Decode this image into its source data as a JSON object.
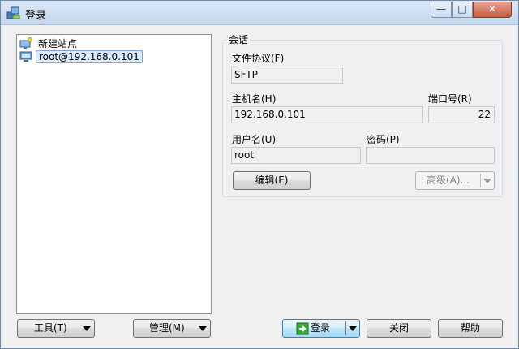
{
  "window": {
    "title": "登录",
    "minimize_glyph": "—",
    "maximize_glyph": "□",
    "close_glyph": "✕"
  },
  "sites": {
    "items": [
      {
        "label": "新建站点",
        "icon": "new-site-icon"
      },
      {
        "label": "root@192.168.0.101",
        "icon": "computer-icon",
        "selected": true
      }
    ]
  },
  "session": {
    "group_title": "会话",
    "protocol_label": "文件协议(F)",
    "protocol_value": "SFTP",
    "host_label": "主机名(H)",
    "host_value": "192.168.0.101",
    "port_label": "端口号(R)",
    "port_value": "22",
    "user_label": "用户名(U)",
    "user_value": "root",
    "password_label": "密码(P)",
    "password_value": "",
    "edit_button": "编辑(E)",
    "advanced_button": "高级(A)..."
  },
  "footer": {
    "tools_button": "工具(T)",
    "manage_button": "管理(M)",
    "login_button": "登录",
    "close_button": "关闭",
    "help_button": "帮助"
  },
  "colors": {
    "selection": "#dcebfc",
    "default_button": "#bee6fd",
    "login_icon": "#3aa83a"
  }
}
